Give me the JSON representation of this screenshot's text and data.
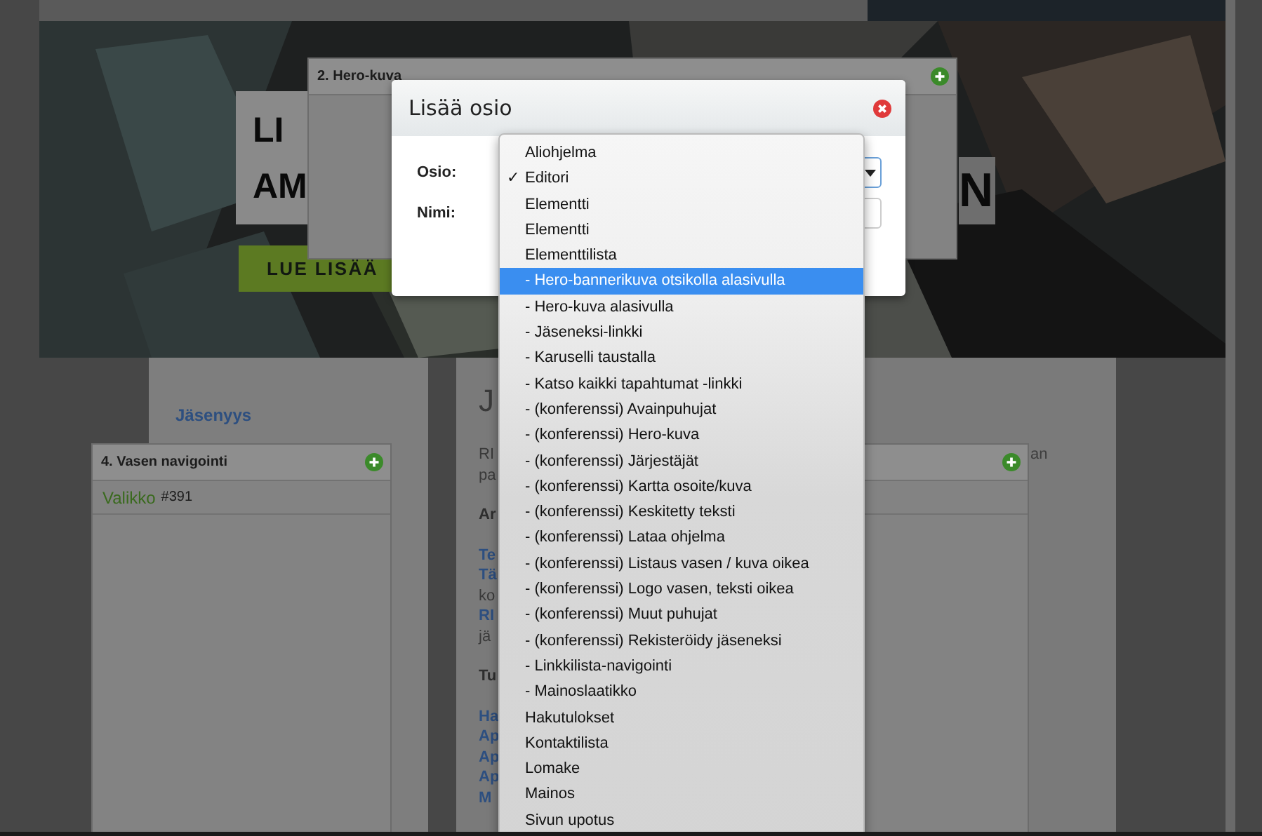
{
  "page": {
    "hero": {
      "title_lines": [
        "LI",
        "AM"
      ],
      "title_end": "N",
      "button": "LUE LISÄÄ"
    },
    "sidebar": {
      "heading": "Jäsenyys"
    },
    "content": {
      "heading": "J",
      "paragraphs": [
        [
          {
            "text": "RI",
            "kind": "plain"
          },
          {
            "text": "pa",
            "kind": "plain"
          }
        ],
        [
          {
            "text": "Ar",
            "kind": "bold"
          }
        ],
        [
          {
            "text": "Te",
            "kind": "link"
          },
          {
            "text": "Tä",
            "kind": "link"
          },
          {
            "text": "ko",
            "kind": "plain"
          },
          {
            "text": "RI",
            "kind": "link"
          },
          {
            "text": "jä",
            "kind": "plain"
          }
        ],
        [
          {
            "text": "Tu",
            "kind": "bold"
          }
        ],
        [
          {
            "text": "Ha",
            "kind": "link"
          },
          {
            "text": "Ap",
            "kind": "link"
          },
          {
            "text": "Ap",
            "kind": "link"
          },
          {
            "text": "Ap",
            "kind": "link"
          },
          {
            "text": "M",
            "kind": "link"
          }
        ]
      ],
      "right_fragment": "an"
    }
  },
  "panels": [
    {
      "title": "2. Hero-kuva"
    },
    {
      "title": "4. Vasen navigointi",
      "items": [
        {
          "label": "Valikko",
          "id": "#391"
        }
      ]
    }
  ],
  "dialog": {
    "title": "Lisää osio",
    "fields": [
      {
        "label": "Osio:",
        "kind": "select"
      },
      {
        "label": "Nimi:",
        "kind": "text"
      }
    ]
  },
  "dropdown": {
    "check_mark": "✓",
    "options": [
      {
        "label": "Aliohjelma",
        "selected": false,
        "checked": false
      },
      {
        "label": "Editori",
        "selected": false,
        "checked": true
      },
      {
        "label": "Elementti",
        "selected": false,
        "checked": false
      },
      {
        "label": "Elementti",
        "selected": false,
        "checked": false
      },
      {
        "label": "Elementtilista",
        "selected": false,
        "checked": false
      },
      {
        "label": "- Hero-bannerikuva otsikolla alasivulla",
        "selected": true,
        "checked": false
      },
      {
        "label": "- Hero-kuva alasivulla",
        "selected": false,
        "checked": false
      },
      {
        "label": "- Jäseneksi-linkki",
        "selected": false,
        "checked": false
      },
      {
        "label": "- Karuselli taustalla",
        "selected": false,
        "checked": false
      },
      {
        "label": "- Katso kaikki tapahtumat -linkki",
        "selected": false,
        "checked": false
      },
      {
        "label": "- (konferenssi) Avainpuhujat",
        "selected": false,
        "checked": false
      },
      {
        "label": "- (konferenssi) Hero-kuva",
        "selected": false,
        "checked": false
      },
      {
        "label": "- (konferenssi) Järjestäjät",
        "selected": false,
        "checked": false
      },
      {
        "label": "- (konferenssi) Kartta osoite/kuva",
        "selected": false,
        "checked": false
      },
      {
        "label": "- (konferenssi) Keskitetty teksti",
        "selected": false,
        "checked": false
      },
      {
        "label": "- (konferenssi) Lataa ohjelma",
        "selected": false,
        "checked": false
      },
      {
        "label": "- (konferenssi) Listaus vasen / kuva oikea",
        "selected": false,
        "checked": false
      },
      {
        "label": "- (konferenssi) Logo vasen, teksti oikea",
        "selected": false,
        "checked": false
      },
      {
        "label": "- (konferenssi) Muut puhujat",
        "selected": false,
        "checked": false
      },
      {
        "label": "- (konferenssi) Rekisteröidy jäseneksi",
        "selected": false,
        "checked": false
      },
      {
        "label": "- Linkkilista-navigointi",
        "selected": false,
        "checked": false
      },
      {
        "label": "- Mainoslaatikko",
        "selected": false,
        "checked": false
      },
      {
        "label": "Hakutulokset",
        "selected": false,
        "checked": false
      },
      {
        "label": "Kontaktilista",
        "selected": false,
        "checked": false
      },
      {
        "label": "Lomake",
        "selected": false,
        "checked": false
      },
      {
        "label": "Mainos",
        "selected": false,
        "checked": false
      },
      {
        "label": "Sivun upotus",
        "selected": false,
        "checked": false
      }
    ]
  }
}
